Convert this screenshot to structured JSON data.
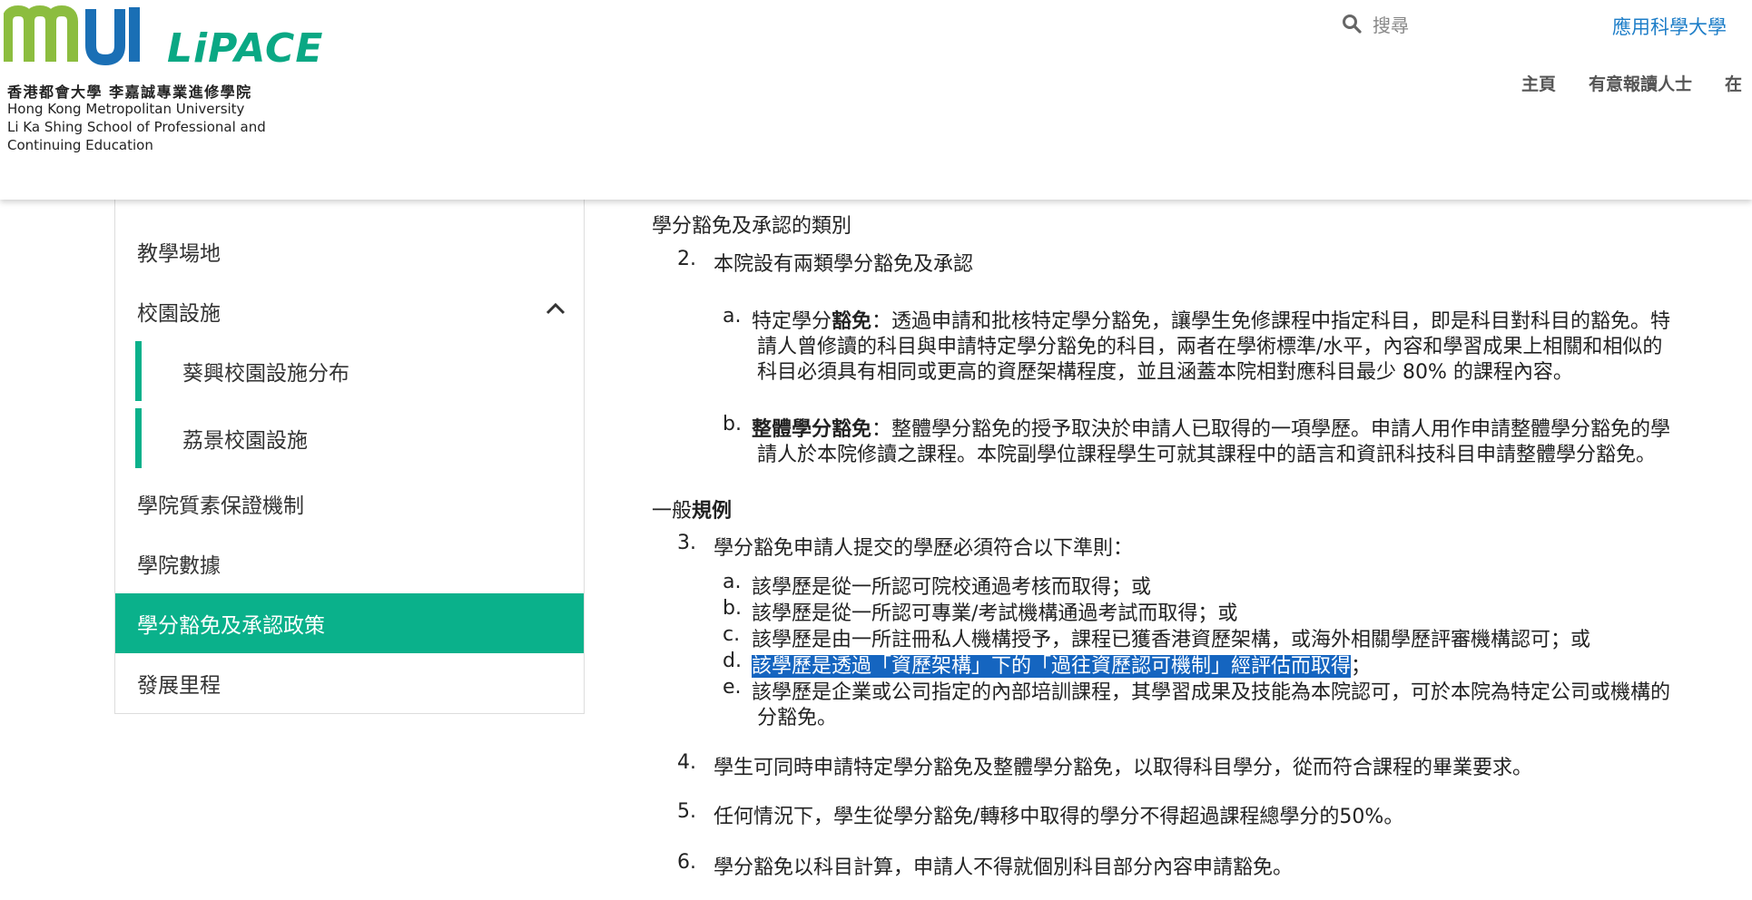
{
  "header": {
    "logo_zh": "香港都會大學 李嘉誠專業進修學院",
    "logo_en_lines": [
      "Hong Kong Metropolitan University",
      "Li Ka Shing School of Professional and",
      "Continuing Education"
    ],
    "logo_brand": "LiPACE",
    "search_placeholder": "搜尋",
    "top_link": "應用科學大學",
    "nav": [
      "主頁",
      "有意報讀人士",
      "在"
    ]
  },
  "sidebar": {
    "items": [
      {
        "label": "教學場地"
      },
      {
        "label": "校園設施"
      },
      {
        "label": "葵興校園設施分布"
      },
      {
        "label": "荔景校園設施"
      },
      {
        "label": "學院質素保證機制"
      },
      {
        "label": "學院數據"
      },
      {
        "label": "學分豁免及承認政策"
      },
      {
        "label": "發展里程"
      }
    ]
  },
  "content": {
    "section1_title": "學分豁免及承認的類別",
    "p2": {
      "num": "2.",
      "text": "本院設有兩類學分豁免及承認"
    },
    "p2a": {
      "letter": "a.",
      "term_prefix": "特定學分",
      "term_bold": "豁免",
      "line1": "：透過申請和批核特定學分豁免，讓學生免修課程中指定科目，即是科目對科目的豁免。特",
      "line2": "請人曾修讀的科目與申請特定學分豁免的科目，兩者在學術標準/水平，內容和學習成果上相關和相似的",
      "line3": "科目必須具有相同或更高的資歷架構程度，並且涵蓋本院相對應科目最少 80% 的課程內容。"
    },
    "p2b": {
      "letter": "b.",
      "term": "整體學分豁免",
      "line1": "：整體學分豁免的授予取決於申請人已取得的一項學歷。申請人用作申請整體學分豁免的學",
      "line2": "請人於本院修讀之課程。本院副學位課程學生可就其課程中的語言和資訊科技科目申請整體學分豁免。"
    },
    "section2_title_prefix": "一般",
    "section2_title_bold": "規例",
    "p3": {
      "num": "3.",
      "text": "學分豁免申請人提交的學歷必須符合以下準則："
    },
    "p3_items": [
      {
        "letter": "a.",
        "text": "該學歷是從一所認可院校通過考核而取得；或"
      },
      {
        "letter": "b.",
        "text": "該學歷是從一所認可專業/考試機構通過考試而取得；或"
      },
      {
        "letter": "c.",
        "text": "該學歷是由一所註冊私人機構授予，課程已獲香港資歷架構，或海外相關學歷評審機構認可；或"
      },
      {
        "letter": "d.",
        "text": "該學歷是透過「資歷架構」下的「過往資歷認可機制」經評估而取得",
        "suffix": "；"
      },
      {
        "letter": "e.",
        "text": "該學歷是企業或公司指定的內部培訓課程，其學習成果及技能為本院認可，可於本院為特定公司或機構的",
        "line2": "分豁免。"
      }
    ],
    "p4": {
      "num": "4.",
      "text": "學生可同時申請特定學分豁免及整體學分豁免，以取得科目學分，從而符合課程的畢業要求。"
    },
    "p5": {
      "num": "5.",
      "text": "任何情況下，學生從學分豁免/轉移中取得的學分不得超過課程總學分的50%。"
    },
    "p6": {
      "num": "6.",
      "text": "學分豁免以科目計算，申請人不得就個別科目部分內容申請豁免。"
    }
  }
}
